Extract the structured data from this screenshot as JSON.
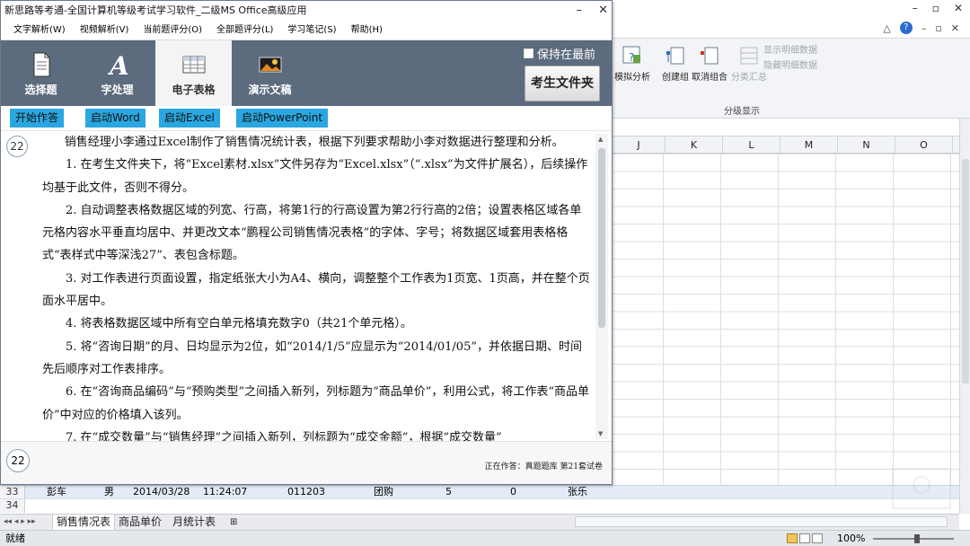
{
  "excel": {
    "window_controls": [
      "–",
      "▫",
      "✕"
    ],
    "help_row": [
      "△",
      "?",
      "–",
      "▫",
      "✕"
    ],
    "ribbon": {
      "what_if_label": "模拟分析",
      "group_label": "创建组",
      "ungroup_label": "取消组合",
      "subtotal_label": "分类汇总",
      "show_detail": "显示明细数据",
      "hide_detail": "隐藏明细数据",
      "outline_group_title": "分级显示"
    },
    "columns": [
      "J",
      "K",
      "L",
      "M",
      "N",
      "O"
    ],
    "row33": {
      "num": "33",
      "name": "彭车",
      "gender": "男",
      "date": "2014/03/28",
      "time": "11:24:07",
      "code": "011203",
      "type": "团购",
      "qty": "5",
      "val": "0",
      "manager": "张乐"
    },
    "row34": {
      "num": "34"
    },
    "sheet_tabs": [
      "销售情况表",
      "商品单价",
      "月统计表"
    ],
    "status_ready": "就绪",
    "zoom": "100%"
  },
  "tutor": {
    "title": "新思路等考通-全国计算机等级考试学习软件_二级MS Office高级应用",
    "window_controls": [
      "–",
      "✕"
    ],
    "menu": [
      "文字解析(W)",
      "视频解析(V)",
      "当前题评分(O)",
      "全部题评分(L)",
      "学习笔记(S)",
      "帮助(H)"
    ],
    "toolbar": {
      "tabs": [
        "选择题",
        "字处理",
        "电子表格",
        "演示文稿"
      ],
      "active_index": 2,
      "always_on_top": "保持在最前",
      "folder_button": "考生文件夹"
    },
    "actions": [
      "开始作答",
      "启动Word",
      "启动Excel",
      "启动PowerPoint"
    ],
    "question_number": "22",
    "paragraphs": [
      "销售经理小李通过Excel制作了销售情况统计表，根据下列要求帮助小李对数据进行整理和分析。",
      "1. 在考生文件夹下，将“Excel素材.xlsx”文件另存为“Excel.xlsx”（“.xlsx”为文件扩展名），后续操作均基于此文件，否则不得分。",
      "2. 自动调整表格数据区域的列宽、行高，将第1行的行高设置为第2行行高的2倍；设置表格区域各单元格内容水平垂直均居中、并更改文本“鹏程公司销售情况表格”的字体、字号；将数据区域套用表格格式“表样式中等深浅27”、表包含标题。",
      "3. 对工作表进行页面设置，指定纸张大小为A4、横向，调整整个工作表为1页宽、1页高，并在整个页面水平居中。",
      "4. 将表格数据区域中所有空白单元格填充数字0（共21个单元格）。",
      "5. 将“咨询日期”的月、日均显示为2位，如“2014/1/5”应显示为“2014/01/05”，并依据日期、时间先后顺序对工作表排序。",
      "6. 在“咨询商品编码”与“预购类型”之间插入新列，列标题为“商品单价”，利用公式，将工作表“商品单价”中对应的价格填入该列。",
      "7. 在“成交数量”与“销售经理”之间插入新列，列标题为“成交金额”，根据“成交数量”"
    ],
    "footer_number": "22",
    "footer_status": "正在作答：真题题库  第21套试卷"
  }
}
